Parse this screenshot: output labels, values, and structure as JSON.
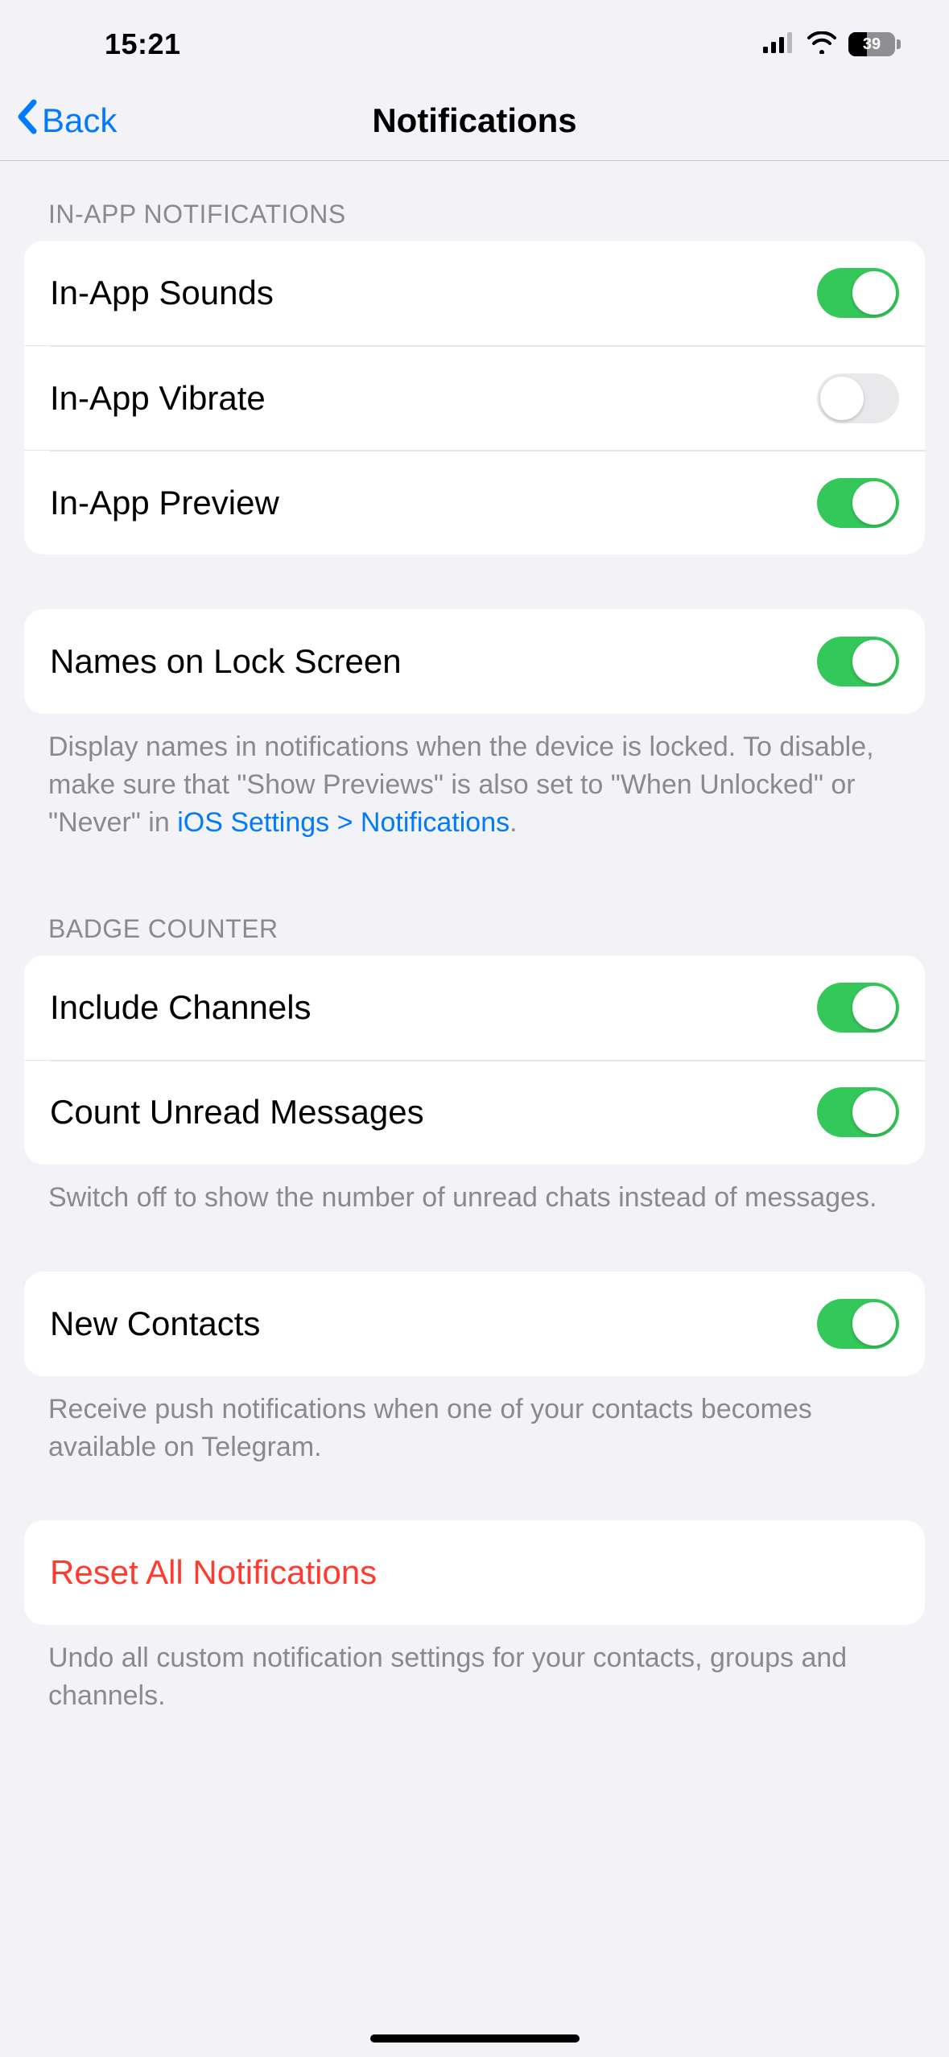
{
  "status": {
    "time": "15:21",
    "battery": "39"
  },
  "nav": {
    "back": "Back",
    "title": "Notifications"
  },
  "sections": {
    "inapp": {
      "header": "IN-APP NOTIFICATIONS",
      "sounds": {
        "label": "In-App Sounds",
        "on": true
      },
      "vibrate": {
        "label": "In-App Vibrate",
        "on": false
      },
      "preview": {
        "label": "In-App Preview",
        "on": true
      }
    },
    "lockscreen": {
      "names": {
        "label": "Names on Lock Screen",
        "on": true
      },
      "footer_pre": "Display names in notifications when the device is locked. To disable, make sure that \"Show Previews\" is also set to \"When Unlocked\" or \"Never\" in ",
      "footer_link": "iOS Settings > Notifications",
      "footer_post": "."
    },
    "badge": {
      "header": "BADGE COUNTER",
      "channels": {
        "label": "Include Channels",
        "on": true
      },
      "unread": {
        "label": "Count Unread Messages",
        "on": true
      },
      "footer": "Switch off to show the number of unread chats instead of messages."
    },
    "contacts": {
      "new": {
        "label": "New Contacts",
        "on": true
      },
      "footer": "Receive push notifications when one of your contacts becomes available on Telegram."
    },
    "reset": {
      "label": "Reset All Notifications",
      "footer": "Undo all custom notification settings for your contacts, groups and channels."
    }
  }
}
